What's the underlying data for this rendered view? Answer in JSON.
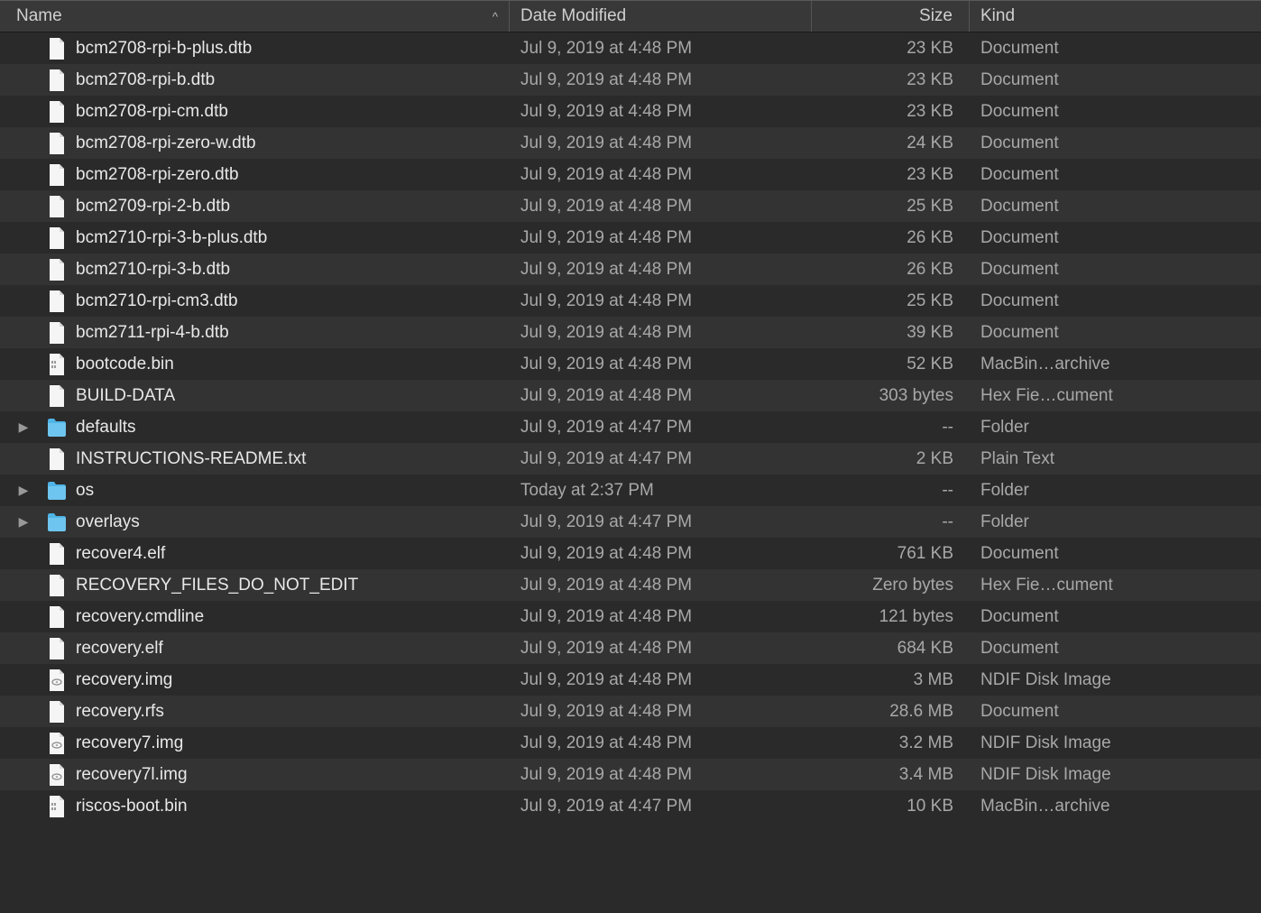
{
  "columns": {
    "name": "Name",
    "date": "Date Modified",
    "size": "Size",
    "kind": "Kind",
    "sort_indicator": "^"
  },
  "files": [
    {
      "name": "bcm2708-rpi-b-plus.dtb",
      "date": "Jul 9, 2019 at 4:48 PM",
      "size": "23 KB",
      "kind": "Document",
      "icon": "file",
      "expandable": false
    },
    {
      "name": "bcm2708-rpi-b.dtb",
      "date": "Jul 9, 2019 at 4:48 PM",
      "size": "23 KB",
      "kind": "Document",
      "icon": "file",
      "expandable": false
    },
    {
      "name": "bcm2708-rpi-cm.dtb",
      "date": "Jul 9, 2019 at 4:48 PM",
      "size": "23 KB",
      "kind": "Document",
      "icon": "file",
      "expandable": false
    },
    {
      "name": "bcm2708-rpi-zero-w.dtb",
      "date": "Jul 9, 2019 at 4:48 PM",
      "size": "24 KB",
      "kind": "Document",
      "icon": "file",
      "expandable": false
    },
    {
      "name": "bcm2708-rpi-zero.dtb",
      "date": "Jul 9, 2019 at 4:48 PM",
      "size": "23 KB",
      "kind": "Document",
      "icon": "file",
      "expandable": false
    },
    {
      "name": "bcm2709-rpi-2-b.dtb",
      "date": "Jul 9, 2019 at 4:48 PM",
      "size": "25 KB",
      "kind": "Document",
      "icon": "file",
      "expandable": false
    },
    {
      "name": "bcm2710-rpi-3-b-plus.dtb",
      "date": "Jul 9, 2019 at 4:48 PM",
      "size": "26 KB",
      "kind": "Document",
      "icon": "file",
      "expandable": false
    },
    {
      "name": "bcm2710-rpi-3-b.dtb",
      "date": "Jul 9, 2019 at 4:48 PM",
      "size": "26 KB",
      "kind": "Document",
      "icon": "file",
      "expandable": false
    },
    {
      "name": "bcm2710-rpi-cm3.dtb",
      "date": "Jul 9, 2019 at 4:48 PM",
      "size": "25 KB",
      "kind": "Document",
      "icon": "file",
      "expandable": false
    },
    {
      "name": "bcm2711-rpi-4-b.dtb",
      "date": "Jul 9, 2019 at 4:48 PM",
      "size": "39 KB",
      "kind": "Document",
      "icon": "file",
      "expandable": false
    },
    {
      "name": "bootcode.bin",
      "date": "Jul 9, 2019 at 4:48 PM",
      "size": "52 KB",
      "kind": "MacBin…archive",
      "icon": "binfile",
      "expandable": false
    },
    {
      "name": "BUILD-DATA",
      "date": "Jul 9, 2019 at 4:48 PM",
      "size": "303 bytes",
      "kind": "Hex Fie…cument",
      "icon": "file",
      "expandable": false
    },
    {
      "name": "defaults",
      "date": "Jul 9, 2019 at 4:47 PM",
      "size": "--",
      "kind": "Folder",
      "icon": "folder",
      "expandable": true
    },
    {
      "name": "INSTRUCTIONS-README.txt",
      "date": "Jul 9, 2019 at 4:47 PM",
      "size": "2 KB",
      "kind": "Plain Text",
      "icon": "file",
      "expandable": false
    },
    {
      "name": "os",
      "date": "Today at 2:37 PM",
      "size": "--",
      "kind": "Folder",
      "icon": "folder",
      "expandable": true
    },
    {
      "name": "overlays",
      "date": "Jul 9, 2019 at 4:47 PM",
      "size": "--",
      "kind": "Folder",
      "icon": "folder",
      "expandable": true
    },
    {
      "name": "recover4.elf",
      "date": "Jul 9, 2019 at 4:48 PM",
      "size": "761 KB",
      "kind": "Document",
      "icon": "file",
      "expandable": false
    },
    {
      "name": "RECOVERY_FILES_DO_NOT_EDIT",
      "date": "Jul 9, 2019 at 4:48 PM",
      "size": "Zero bytes",
      "kind": "Hex Fie…cument",
      "icon": "file",
      "expandable": false
    },
    {
      "name": "recovery.cmdline",
      "date": "Jul 9, 2019 at 4:48 PM",
      "size": "121 bytes",
      "kind": "Document",
      "icon": "file",
      "expandable": false
    },
    {
      "name": "recovery.elf",
      "date": "Jul 9, 2019 at 4:48 PM",
      "size": "684 KB",
      "kind": "Document",
      "icon": "file",
      "expandable": false
    },
    {
      "name": "recovery.img",
      "date": "Jul 9, 2019 at 4:48 PM",
      "size": "3 MB",
      "kind": "NDIF Disk Image",
      "icon": "diskimg",
      "expandable": false
    },
    {
      "name": "recovery.rfs",
      "date": "Jul 9, 2019 at 4:48 PM",
      "size": "28.6 MB",
      "kind": "Document",
      "icon": "file",
      "expandable": false
    },
    {
      "name": "recovery7.img",
      "date": "Jul 9, 2019 at 4:48 PM",
      "size": "3.2 MB",
      "kind": "NDIF Disk Image",
      "icon": "diskimg",
      "expandable": false
    },
    {
      "name": "recovery7l.img",
      "date": "Jul 9, 2019 at 4:48 PM",
      "size": "3.4 MB",
      "kind": "NDIF Disk Image",
      "icon": "diskimg",
      "expandable": false
    },
    {
      "name": "riscos-boot.bin",
      "date": "Jul 9, 2019 at 4:47 PM",
      "size": "10 KB",
      "kind": "MacBin…archive",
      "icon": "binfile",
      "expandable": false
    }
  ]
}
